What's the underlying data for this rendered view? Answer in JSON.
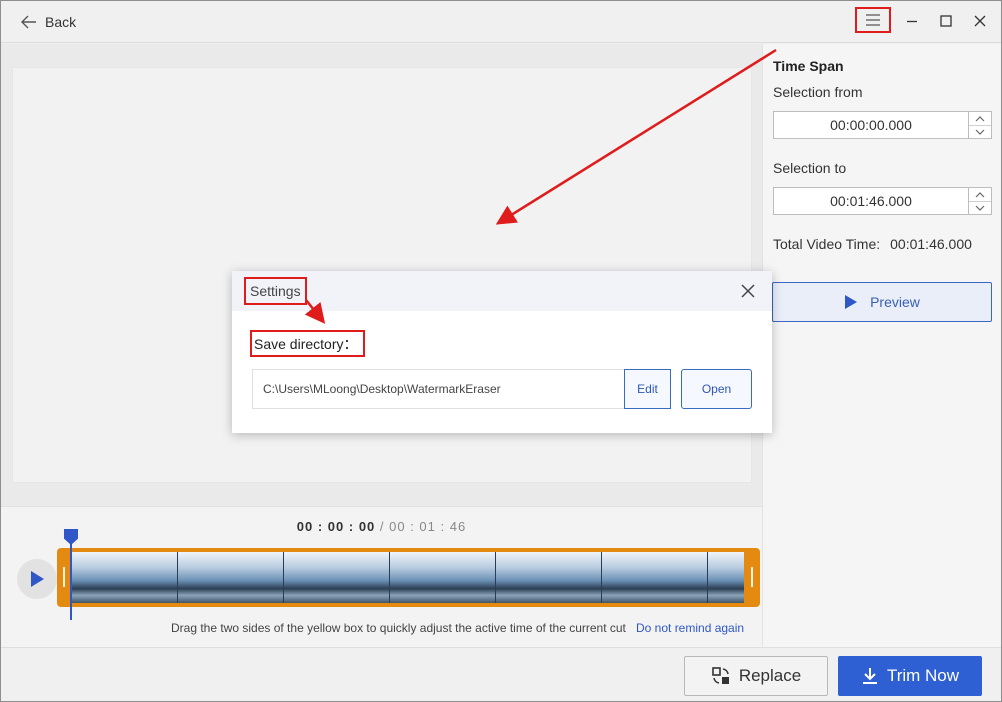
{
  "titlebar": {
    "back_label": "Back"
  },
  "right_panel": {
    "title": "Time Span",
    "selection_from_label": "Selection from",
    "selection_from_value": "00:00:00.000",
    "selection_to_label": "Selection to",
    "selection_to_value": "00:01:46.000",
    "total_label": "Total Video Time:",
    "total_value": "00:01:46.000",
    "preview_label": "Preview"
  },
  "timeline": {
    "current": "00 : 00 : 00",
    "separator": " / ",
    "total": "00 : 01 : 46",
    "hint": "Drag the two sides of the yellow box to quickly adjust the active time of the current cut",
    "hint_link": "Do not remind again",
    "frame_count": 7
  },
  "footer": {
    "replace_label": "Replace",
    "trim_label": "Trim Now"
  },
  "dialog": {
    "title": "Settings",
    "save_label": "Save directory：",
    "path": "C:\\Users\\MLoong\\Desktop\\WatermarkEraser",
    "edit_label": "Edit",
    "open_label": "Open"
  },
  "colors": {
    "accent": "#2e5fd3",
    "strip": "#e48a10",
    "annotation": "#e01b1b"
  },
  "icons": [
    "back-arrow-icon",
    "menu-icon",
    "minimize-icon",
    "maximize-icon",
    "close-icon",
    "chevron-up-icon",
    "chevron-down-icon",
    "play-icon",
    "replace-icon",
    "download-icon"
  ]
}
